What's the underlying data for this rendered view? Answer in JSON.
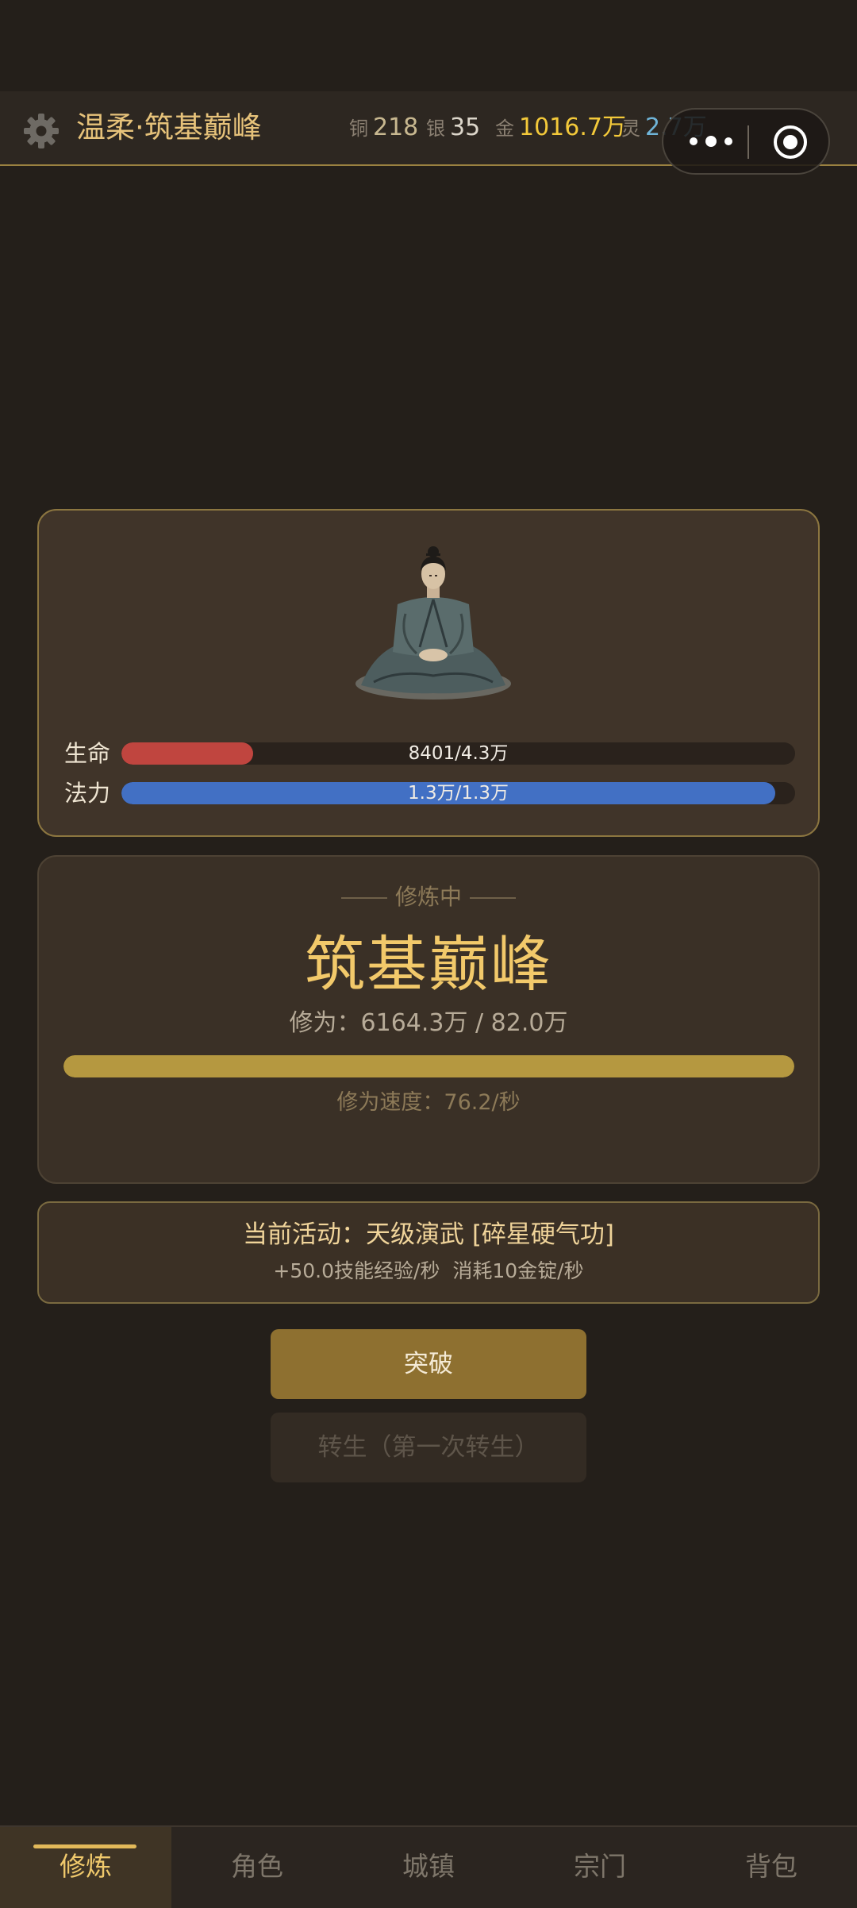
{
  "header": {
    "title": "温柔·筑基巅峰",
    "settings_icon": "gear-icon",
    "currencies": {
      "copper": {
        "label": "铜",
        "value": "218",
        "color": "#c8b890"
      },
      "silver": {
        "label": "银",
        "value": "35",
        "color": "#dcd6ca"
      },
      "gold": {
        "label": "金",
        "value": "1016.7万",
        "color": "#f3c93a"
      },
      "spirit": {
        "label": "灵",
        "value": "2.7万",
        "color": "#6fb4d8"
      }
    },
    "capsule": {
      "more_icon": "more-dots-icon",
      "close_icon": "target-circle-icon"
    }
  },
  "character": {
    "portrait_icon": "meditating-cultivator-figure",
    "hp": {
      "label": "生命",
      "text": "8401/4.3万",
      "fraction": 0.195,
      "color": "#c0453f"
    },
    "mp": {
      "label": "法力",
      "text": "1.3万/1.3万",
      "fraction": 1.0,
      "color": "#4270c4"
    }
  },
  "cultivation": {
    "status": "修炼中",
    "realm": "筑基巅峰",
    "progress_text": "修为：6164.3万 / 82.0万",
    "progress_fraction": 1.0,
    "speed_text": "修为速度：76.2/秒"
  },
  "activity": {
    "title": "当前活动：天级演武 [碎星硬气功]",
    "detail": "+50.0技能经验/秒  消耗10金锭/秒"
  },
  "buttons": {
    "breakthrough": "突破",
    "rebirth": "转生（第一次转生）"
  },
  "nav": {
    "tabs": [
      "修炼",
      "角色",
      "城镇",
      "宗门",
      "背包"
    ],
    "active_index": 0
  }
}
